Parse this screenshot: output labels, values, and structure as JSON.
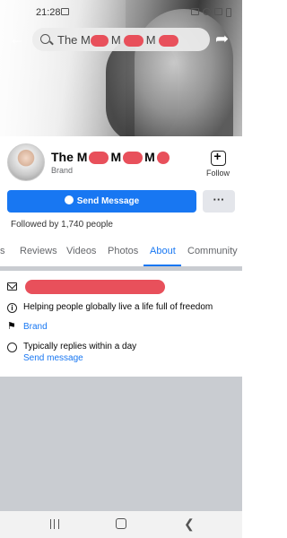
{
  "status_bar": {
    "time": "21:28"
  },
  "search": {
    "text": "The M"
  },
  "page": {
    "name_start": "The M",
    "category": "Brand",
    "follow_label": "Follow",
    "send_message_label": "Send Message",
    "more_label": "···",
    "followers_text": "Followed by 1,740 people"
  },
  "tabs": [
    {
      "label": "s"
    },
    {
      "label": "Reviews"
    },
    {
      "label": "Videos"
    },
    {
      "label": "Photos"
    },
    {
      "label": "About",
      "active": true
    },
    {
      "label": "Community"
    }
  ],
  "about": {
    "tagline": "Helping people globally live a life full of freedom",
    "category_link": "Brand",
    "reply_time": "Typically replies within a day",
    "send_message_link": "Send message"
  },
  "icons": {
    "back": "arrow-left-icon",
    "share": "share-icon",
    "search": "search-icon",
    "follow": "follow-icon",
    "email": "envelope-icon",
    "info": "info-icon",
    "category": "flag-icon",
    "messenger": "messenger-icon"
  },
  "colors": {
    "accent": "#1877f2",
    "redaction": "#e8505b",
    "section_gray": "#c9ccd1"
  }
}
